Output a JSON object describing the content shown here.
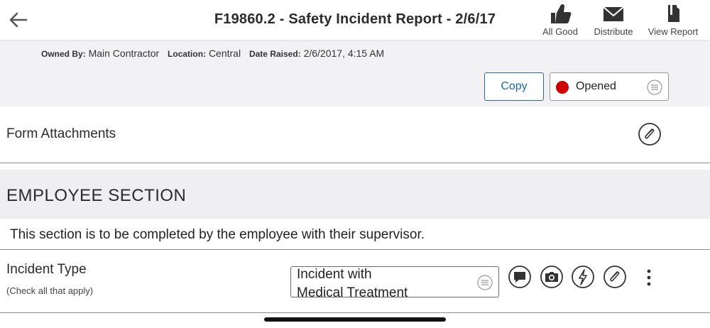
{
  "header": {
    "title": "F19860.2 - Safety Incident Report - 2/6/17",
    "actions": [
      {
        "label": "All Good",
        "icon": "thumbs-up-icon"
      },
      {
        "label": "Distribute",
        "icon": "envelope-icon"
      },
      {
        "label": "View Report",
        "icon": "report-icon"
      }
    ]
  },
  "meta": {
    "owned_by_label": "Owned By:",
    "owned_by": "Main Contractor",
    "location_label": "Location:",
    "location": "Central",
    "date_raised_label": "Date Raised:",
    "date_raised": "2/6/2017, 4:15 AM"
  },
  "controls": {
    "copy_label": "Copy",
    "status": "Opened",
    "status_color": "#cc0000"
  },
  "attachments": {
    "label": "Form Attachments"
  },
  "section": {
    "title": "EMPLOYEE SECTION",
    "description": "This section is to be completed by the employee with their supervisor."
  },
  "incident_type": {
    "label": "Incident Type",
    "hint": "(Check all that apply)",
    "value_line1": "Incident with",
    "value_line2": "Medical Treatment",
    "row_icons": [
      "comment-icon",
      "camera-icon",
      "lightning-icon",
      "paperclip-icon",
      "more-vertical-icon"
    ]
  },
  "colors": {
    "accent": "#1a6aa8",
    "band": "#f2f2f5",
    "status_red": "#cc0000"
  }
}
